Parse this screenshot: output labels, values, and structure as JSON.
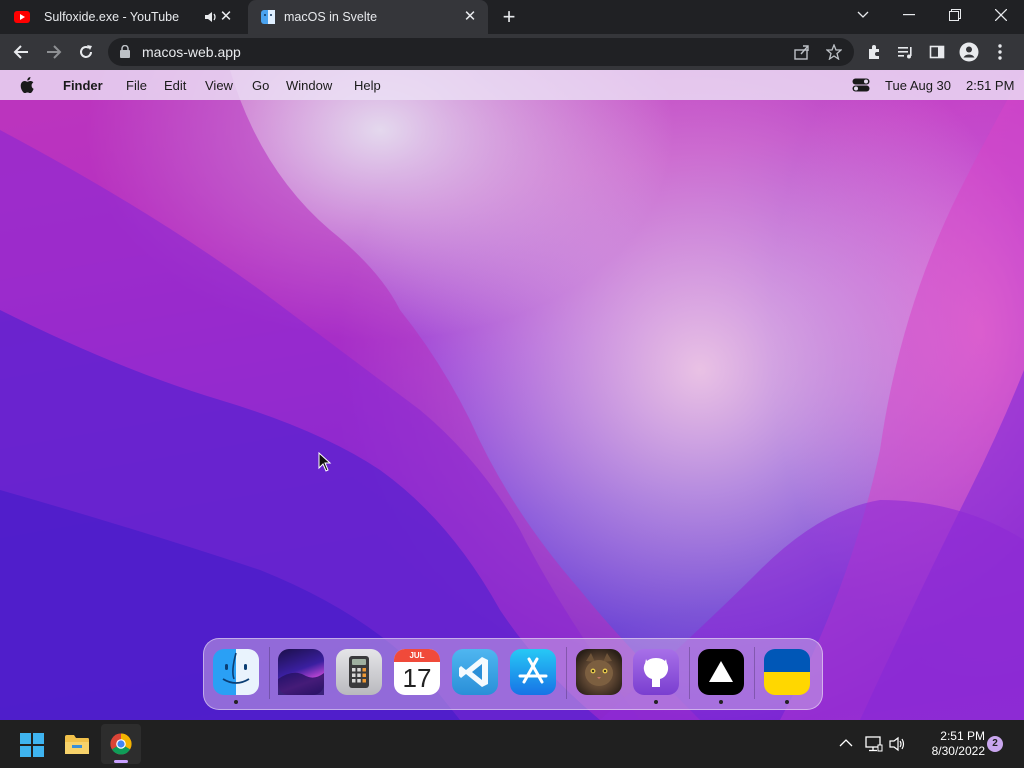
{
  "browser": {
    "tabs": [
      {
        "title": "Sulfoxide.exe - YouTube",
        "favicon": "youtube-icon",
        "audio": true
      },
      {
        "title": "macOS in Svelte",
        "favicon": "finder-icon",
        "active": true
      }
    ],
    "url": "macos-web.app"
  },
  "menubar": {
    "app": "Finder",
    "items": [
      "File",
      "Edit",
      "View",
      "Go",
      "Window",
      "Help"
    ],
    "date": "Tue Aug 30",
    "time": "2:51 PM"
  },
  "dock": {
    "apps": [
      {
        "name": "Finder",
        "running": true
      },
      {
        "name": "Wallpapers",
        "running": false
      },
      {
        "name": "Calculator",
        "running": false
      },
      {
        "name": "Calendar",
        "running": false,
        "month": "JUL",
        "day": "17"
      },
      {
        "name": "VS Code",
        "running": false
      },
      {
        "name": "App Store",
        "running": false
      },
      {
        "name": "Cat Photo",
        "running": false
      },
      {
        "name": "GitHub",
        "running": true
      },
      {
        "name": "Vercel",
        "running": true
      },
      {
        "name": "Ukraine",
        "running": true
      }
    ]
  },
  "taskbar": {
    "time": "2:51 PM",
    "date": "8/30/2022",
    "notifications": "2"
  },
  "colors": {
    "youtube_red": "#ff0000",
    "ukraine_blue": "#0057b7",
    "ukraine_yellow": "#ffd700"
  }
}
